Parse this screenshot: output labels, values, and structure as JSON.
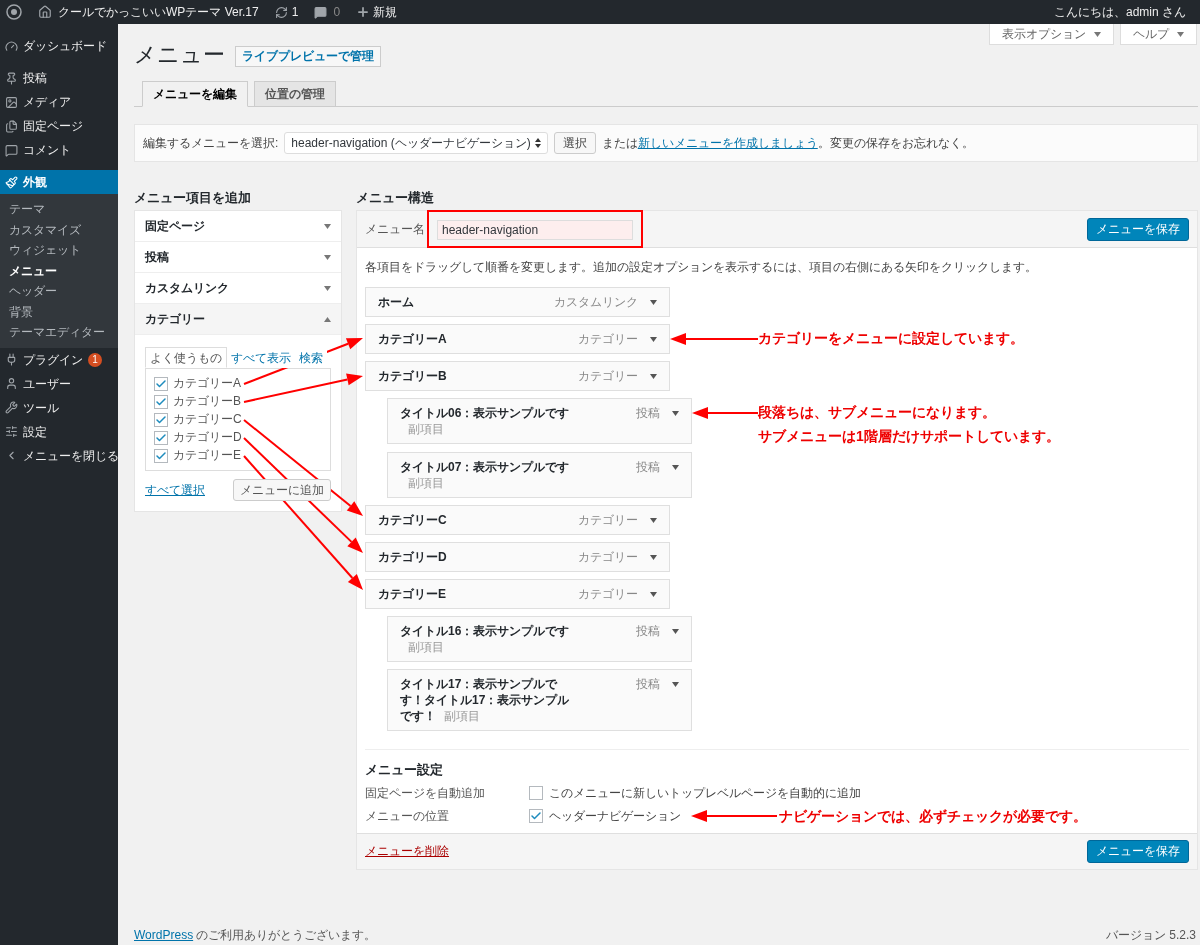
{
  "admin_bar": {
    "site_name": "クールでかっこいいWPテーマ Ver.17",
    "updates": "1",
    "comments": "0",
    "new": "新規",
    "greeting": "こんにちは、admin さん"
  },
  "sidebar": {
    "items": [
      {
        "label": "ダッシュボード",
        "selected": false
      },
      {
        "label": "投稿",
        "selected": false
      },
      {
        "label": "メディア",
        "selected": false
      },
      {
        "label": "固定ページ",
        "selected": false
      },
      {
        "label": "コメント",
        "selected": false
      },
      {
        "label": "外観",
        "selected": true,
        "children": [
          {
            "label": "テーマ",
            "selected": false
          },
          {
            "label": "カスタマイズ",
            "selected": false
          },
          {
            "label": "ウィジェット",
            "selected": false
          },
          {
            "label": "メニュー",
            "selected": true
          },
          {
            "label": "ヘッダー",
            "selected": false
          },
          {
            "label": "背景",
            "selected": false
          },
          {
            "label": "テーマエディター",
            "selected": false
          }
        ]
      },
      {
        "label": "プラグイン",
        "selected": false,
        "badge": "1"
      },
      {
        "label": "ユーザー",
        "selected": false
      },
      {
        "label": "ツール",
        "selected": false
      },
      {
        "label": "設定",
        "selected": false
      },
      {
        "label": "メニューを閉じる",
        "selected": false
      }
    ]
  },
  "screen_meta": [
    "表示オプション",
    "ヘルプ"
  ],
  "page": {
    "title": "メニュー",
    "action": "ライブプレビューで管理"
  },
  "tabs": [
    {
      "label": "メニューを編集",
      "selected": true
    },
    {
      "label": "位置の管理",
      "selected": false
    }
  ],
  "menu_select": {
    "label": "編集するメニューを選択:",
    "value": "header-navigation (ヘッダーナビゲーション)",
    "button": "選択",
    "text_before": "または",
    "link": "新しいメニューを作成しましょう",
    "text_after": "。変更の保存をお忘れなく。"
  },
  "add_items": {
    "heading": "メニュー項目を追加",
    "sections": [
      {
        "title": "固定ページ",
        "expanded": false
      },
      {
        "title": "投稿",
        "expanded": false
      },
      {
        "title": "カスタムリンク",
        "expanded": false
      },
      {
        "title": "カテゴリー",
        "expanded": true
      }
    ],
    "category_tabs": [
      {
        "label": "よく使うもの",
        "selected": true
      },
      {
        "label": "すべて表示",
        "selected": false
      },
      {
        "label": "検索",
        "selected": false
      }
    ],
    "categories": [
      {
        "label": "カテゴリーA",
        "checked": true
      },
      {
        "label": "カテゴリーB",
        "checked": true
      },
      {
        "label": "カテゴリーC",
        "checked": true
      },
      {
        "label": "カテゴリーD",
        "checked": true
      },
      {
        "label": "カテゴリーE",
        "checked": true
      }
    ],
    "select_all": "すべて選択",
    "add_button": "メニューに追加"
  },
  "structure": {
    "heading": "メニュー構造",
    "name_label": "メニュー名",
    "name_value": "header-navigation",
    "name_highlighted": true,
    "save_button": "メニューを保存",
    "instructions": "各項目をドラッグして順番を変更します。追加の設定オプションを表示するには、項目の右側にある矢印をクリックします。",
    "items": [
      {
        "title": "ホーム",
        "type": "カスタムリンク"
      },
      {
        "title": "カテゴリーA",
        "type": "カテゴリー",
        "note": [
          "カテゴリーをメニューに設定しています。"
        ]
      },
      {
        "title": "カテゴリーB",
        "type": "カテゴリー",
        "children": [
          {
            "title": "タイトル06：表示サンプルです",
            "sub_label": "副項目",
            "type": "投稿",
            "note": [
              "段落ちは、サブメニューになります。",
              "サブメニューは1階層だけサポートしています。"
            ]
          },
          {
            "title": "タイトル07：表示サンプルです",
            "sub_label": "副項目",
            "type": "投稿"
          }
        ]
      },
      {
        "title": "カテゴリーC",
        "type": "カテゴリー"
      },
      {
        "title": "カテゴリーD",
        "type": "カテゴリー"
      },
      {
        "title": "カテゴリーE",
        "type": "カテゴリー",
        "children": [
          {
            "title": "タイトル16：表示サンプルです",
            "sub_label": "副項目",
            "type": "投稿"
          },
          {
            "title": "タイトル17：表示サンプルです！タイトル17：表示サンプルです！",
            "sub_label": "副項目",
            "type": "投稿"
          }
        ]
      }
    ],
    "settings": {
      "heading": "メニュー設定",
      "rows": [
        {
          "label": "固定ページを自動追加",
          "option": "このメニューに新しいトップレベルページを自動的に追加",
          "checked": false
        },
        {
          "label": "メニューの位置",
          "option": "ヘッダーナビゲーション",
          "checked": true,
          "note": [
            "ナビゲーションでは、必ずチェックが必要です。"
          ]
        }
      ]
    },
    "delete_link": "メニューを削除",
    "save_button_bottom": "メニューを保存"
  },
  "footer": {
    "link": "WordPress",
    "text": "のご利用ありがとうございます。",
    "version": "バージョン 5.2.3"
  }
}
